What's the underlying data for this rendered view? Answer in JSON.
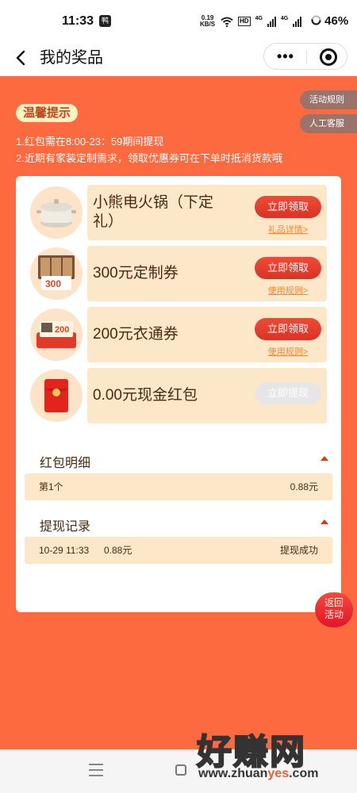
{
  "status": {
    "time": "11:33",
    "notification_badge": "鸭",
    "speed_value": "0.19",
    "speed_unit": "KB/S",
    "hd": "HD",
    "net1": "4G",
    "net2": "4G",
    "battery": "46%"
  },
  "header": {
    "title": "我的奖品"
  },
  "side_buttons": {
    "rules": "活动规则",
    "service": "人工客服"
  },
  "tip": {
    "badge": "温馨提示",
    "line1": "1.红包需在8:00-23：59期间提现",
    "line2": "2.近期有家装定制需求，领取优惠券可在下单时抵消货款哦"
  },
  "prizes": [
    {
      "name": "小熊电火锅（下定礼）",
      "button": "立即领取",
      "link": "礼品详情>",
      "image": "hot-pot"
    },
    {
      "name": "300元定制券",
      "button": "立即领取",
      "link": "使用规则>",
      "image": "cabinet-coupon",
      "image_text": "300"
    },
    {
      "name": "200元衣通券",
      "button": "立即领取",
      "link": "使用规则>",
      "image": "wardrobe-coupon",
      "image_text": "200"
    },
    {
      "name": "0.00元现金红包",
      "button": "立即提现",
      "link": "",
      "image": "red-envelope"
    }
  ],
  "redpacket_detail": {
    "title": "红包明细",
    "rows": [
      {
        "label": "第1个",
        "amount": "0.88元"
      }
    ]
  },
  "withdraw_records": {
    "title": "提现记录",
    "rows": [
      {
        "time": "10-29 11:33",
        "amount": "0.88元",
        "status": "提现成功"
      }
    ]
  },
  "fab": {
    "line1": "返回",
    "line2": "活动"
  },
  "watermark": {
    "big": "好赚网",
    "small_a": "www.zhuan",
    "small_b": "yes",
    "small_c": ".com"
  },
  "colors": {
    "background": "#fd6a40",
    "accent": "#e0392a",
    "cream": "#fde7c9"
  }
}
